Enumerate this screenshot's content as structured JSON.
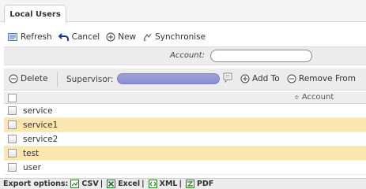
{
  "tabs": [
    {
      "label": "Local Users"
    }
  ],
  "toolbar": {
    "refresh": "Refresh",
    "cancel": "Cancel",
    "new": "New",
    "synchronise": "Synchronise"
  },
  "account_filter": {
    "label": "Account:",
    "value": ""
  },
  "actions": {
    "delete": "Delete",
    "supervisor_label": "Supervisor:",
    "add_to": "Add To",
    "remove_from": "Remove From"
  },
  "grid": {
    "sort_indicator": "≑",
    "column": "Account",
    "rows": [
      {
        "account": "service"
      },
      {
        "account": "service1"
      },
      {
        "account": "service2"
      },
      {
        "account": "test"
      },
      {
        "account": "user"
      }
    ]
  },
  "export": {
    "label": "Export options:",
    "csv": "CSV",
    "excel": "Excel",
    "xml": "XML",
    "pdf": "PDF",
    "separator": "|"
  },
  "colors": {
    "row_highlight": "#fbe6b0",
    "supervisor_fill": "#9ea0dc"
  }
}
